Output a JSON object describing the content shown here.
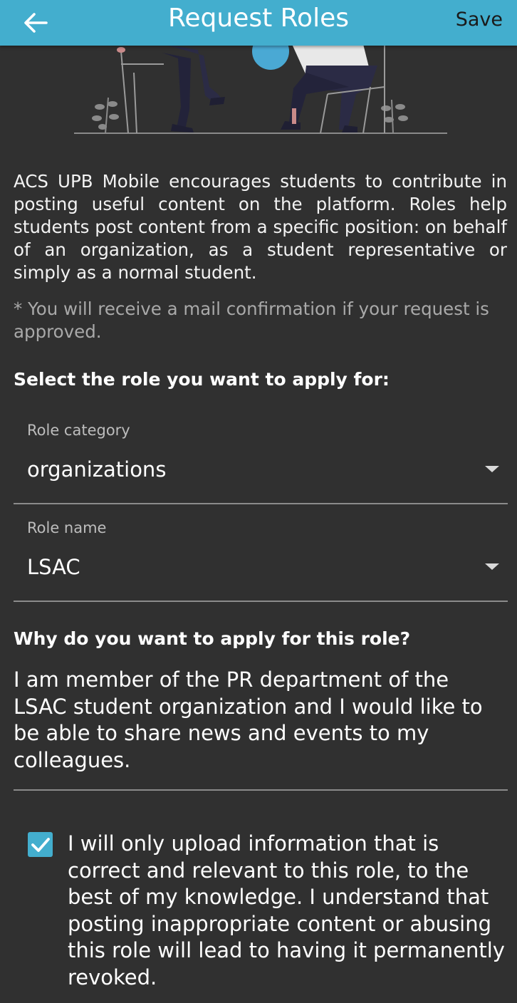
{
  "appbar": {
    "title": "Request Roles",
    "save_label": "Save",
    "back_icon": "arrow-back-icon",
    "color": "#43AECE"
  },
  "illustration": {
    "name": "students-illustration"
  },
  "intro_text": "ACS UPB Mobile encourages students to contribute in posting useful content on the platform. Roles help students post content from a specific position: on behalf of an organization, as a student representative or simply as a normal student.",
  "note_text": "* You will receive a mail confirmation if your request is approved.",
  "section_title": "Select the role you want to apply for:",
  "role_category": {
    "label": "Role category",
    "value": "organizations",
    "icon": "dropdown-arrow-icon"
  },
  "role_name": {
    "label": "Role name",
    "value": "LSAC",
    "icon": "dropdown-arrow-icon"
  },
  "question": "Why do you want to apply for this role?",
  "reason_text": "I am member of the PR department of the LSAC student organization and I would like to be able to share news and events to my colleagues.",
  "agreement": {
    "checked": true,
    "text": "I will only upload information that is correct and relevant to this role, to the best of my knowledge. I understand that posting inappropriate content or abusing this role will lead to having it permanently revoked."
  }
}
